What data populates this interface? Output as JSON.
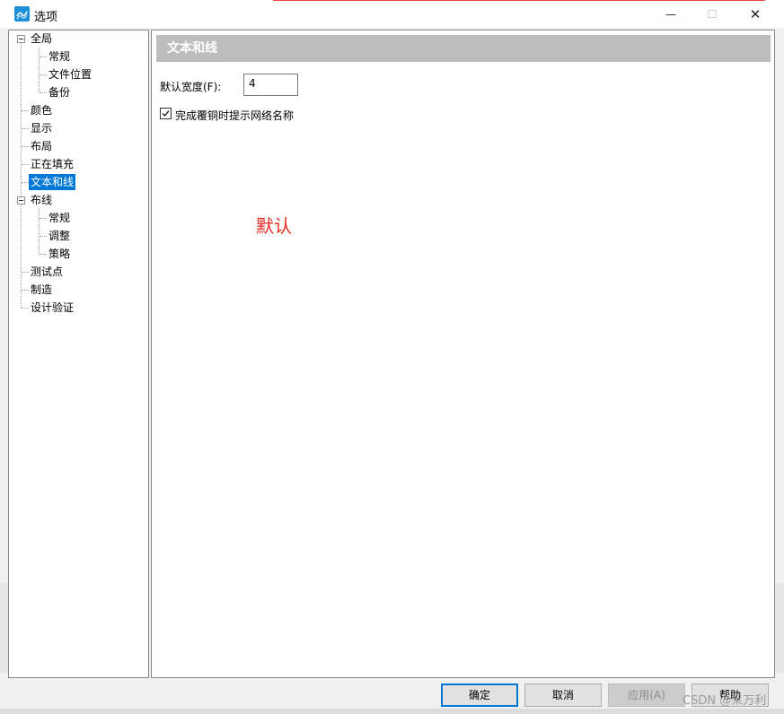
{
  "window": {
    "title": "选项",
    "controls": {
      "minimize": "—",
      "maximize": "☐",
      "close": "✕"
    }
  },
  "tree": {
    "items": [
      {
        "label": "全局",
        "level": 0,
        "expanded": true
      },
      {
        "label": "常规",
        "level": 1
      },
      {
        "label": "文件位置",
        "level": 1
      },
      {
        "label": "备份",
        "level": 1
      },
      {
        "label": "颜色",
        "level": 0
      },
      {
        "label": "显示",
        "level": 0
      },
      {
        "label": "布局",
        "level": 0
      },
      {
        "label": "正在填充",
        "level": 0
      },
      {
        "label": "文本和线",
        "level": 0,
        "selected": true
      },
      {
        "label": "布线",
        "level": 0,
        "expanded": true
      },
      {
        "label": "常规",
        "level": 1
      },
      {
        "label": "调整",
        "level": 1
      },
      {
        "label": "策略",
        "level": 1
      },
      {
        "label": "测试点",
        "level": 0
      },
      {
        "label": "制造",
        "level": 0
      },
      {
        "label": "设计验证",
        "level": 0
      }
    ]
  },
  "content": {
    "header": "文本和线",
    "default_width": {
      "label": "默认宽度(F):",
      "value": "4"
    },
    "checkbox": {
      "label": "完成覆铜时提示网络名称",
      "checked": true
    },
    "annotation": "默认"
  },
  "buttons": {
    "ok": "确定",
    "cancel": "取消",
    "apply": "应用(A)",
    "help": "帮助"
  },
  "watermark": "CSDN @呆万利",
  "colors": {
    "selection": "#0078d7",
    "header_bg": "#bdbdbd",
    "annotation": "#e32b22",
    "app_icon": "#1d8fd6"
  }
}
